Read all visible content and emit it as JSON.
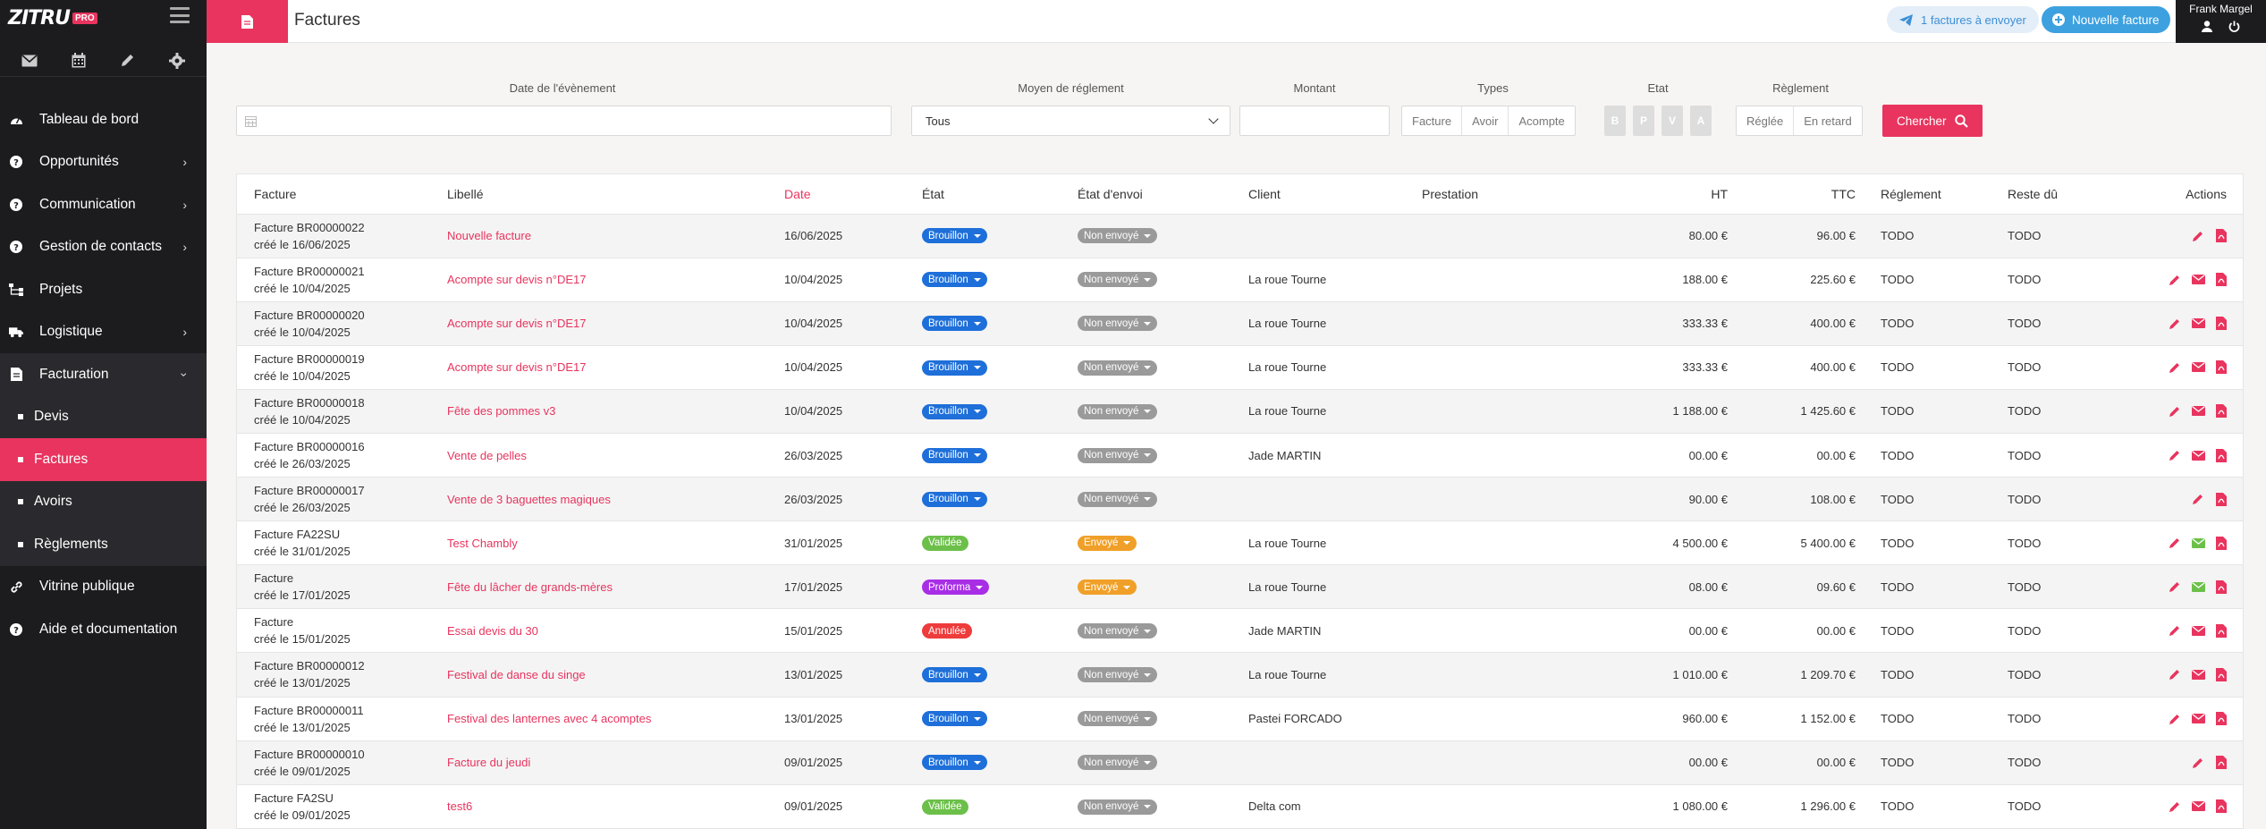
{
  "brand": {
    "name": "ZITRU",
    "badge": "PRO"
  },
  "sidebar": {
    "quick_icons": [
      "mail-icon",
      "calendar-icon",
      "pencil-icon",
      "gear-icon"
    ],
    "items": [
      {
        "label": "Tableau de bord",
        "icon": "dashboard-icon",
        "has_children": false
      },
      {
        "label": "Opportunités",
        "icon": "question-circle-icon",
        "has_children": true
      },
      {
        "label": "Communication",
        "icon": "question-circle-icon",
        "has_children": true
      },
      {
        "label": "Gestion de contacts",
        "icon": "question-circle-icon",
        "has_children": true
      },
      {
        "label": "Projets",
        "icon": "sitemap-icon",
        "has_children": false
      },
      {
        "label": "Logistique",
        "icon": "truck-icon",
        "has_children": true
      },
      {
        "label": "Facturation",
        "icon": "invoice-icon",
        "has_children": true,
        "open": true
      }
    ],
    "subitems": [
      {
        "label": "Devis",
        "active": false
      },
      {
        "label": "Factures",
        "active": true
      },
      {
        "label": "Avoirs",
        "active": false
      },
      {
        "label": "Règlements",
        "active": false
      }
    ],
    "bottom_items": [
      {
        "label": "Vitrine publique",
        "icon": "link-icon"
      },
      {
        "label": "Aide et documentation",
        "icon": "question-circle-icon"
      }
    ]
  },
  "topbar": {
    "title": "Factures",
    "send_button": "1 factures à envoyer",
    "new_button": "Nouvelle facture",
    "user_name": "Frank Margel"
  },
  "filters": {
    "date_label": "Date de l'évènement",
    "payment_label": "Moyen de réglement",
    "payment_value": "Tous",
    "amount_label": "Montant",
    "types_label": "Types",
    "types": [
      "Facture",
      "Avoir",
      "Acompte"
    ],
    "etat_label": "Etat",
    "etats": [
      "B",
      "P",
      "V",
      "A"
    ],
    "reglement_label": "Règlement",
    "reglements": [
      "Réglée",
      "En retard"
    ],
    "search_button": "Chercher"
  },
  "table": {
    "headers": {
      "facture": "Facture",
      "libelle": "Libellé",
      "date": "Date",
      "etat": "État",
      "envoi": "État d'envoi",
      "client": "Client",
      "prestation": "Prestation",
      "ht": "HT",
      "ttc": "TTC",
      "reglement": "Réglement",
      "reste": "Reste dû",
      "actions": "Actions"
    },
    "rows": [
      {
        "num": "Facture BR00000022",
        "created": "créé le 16/06/2025",
        "libelle": "Nouvelle facture",
        "date": "16/06/2025",
        "etat": "Brouillon",
        "envoi": "Non envoyé",
        "client": "",
        "prestation": "",
        "ht": "80.00 €",
        "ttc": "96.00 €",
        "reglement": "TODO",
        "reste": "TODO",
        "mail": false
      },
      {
        "num": "Facture BR00000021",
        "created": "créé le 10/04/2025",
        "libelle": "Acompte sur devis n°DE17",
        "date": "10/04/2025",
        "etat": "Brouillon",
        "envoi": "Non envoyé",
        "client": "La roue Tourne",
        "prestation": "",
        "ht": "188.00 €",
        "ttc": "225.60 €",
        "reglement": "TODO",
        "reste": "TODO",
        "mail": true
      },
      {
        "num": "Facture BR00000020",
        "created": "créé le 10/04/2025",
        "libelle": "Acompte sur devis n°DE17",
        "date": "10/04/2025",
        "etat": "Brouillon",
        "envoi": "Non envoyé",
        "client": "La roue Tourne",
        "prestation": "",
        "ht": "333.33 €",
        "ttc": "400.00 €",
        "reglement": "TODO",
        "reste": "TODO",
        "mail": true
      },
      {
        "num": "Facture BR00000019",
        "created": "créé le 10/04/2025",
        "libelle": "Acompte sur devis n°DE17",
        "date": "10/04/2025",
        "etat": "Brouillon",
        "envoi": "Non envoyé",
        "client": "La roue Tourne",
        "prestation": "",
        "ht": "333.33 €",
        "ttc": "400.00 €",
        "reglement": "TODO",
        "reste": "TODO",
        "mail": true
      },
      {
        "num": "Facture BR00000018",
        "created": "créé le 10/04/2025",
        "libelle": "Fête des pommes v3",
        "date": "10/04/2025",
        "etat": "Brouillon",
        "envoi": "Non envoyé",
        "client": "La roue Tourne",
        "prestation": "",
        "ht": "1 188.00 €",
        "ttc": "1 425.60 €",
        "reglement": "TODO",
        "reste": "TODO",
        "mail": true
      },
      {
        "num": "Facture BR00000016",
        "created": "créé le 26/03/2025",
        "libelle": "Vente de pelles",
        "date": "26/03/2025",
        "etat": "Brouillon",
        "envoi": "Non envoyé",
        "client": "Jade MARTIN",
        "prestation": "",
        "ht": "00.00 €",
        "ttc": "00.00 €",
        "reglement": "TODO",
        "reste": "TODO",
        "mail": true
      },
      {
        "num": "Facture BR00000017",
        "created": "créé le 26/03/2025",
        "libelle": "Vente de 3 baguettes magiques",
        "date": "26/03/2025",
        "etat": "Brouillon",
        "envoi": "Non envoyé",
        "client": "",
        "prestation": "",
        "ht": "90.00 €",
        "ttc": "108.00 €",
        "reglement": "TODO",
        "reste": "TODO",
        "mail": false
      },
      {
        "num": "Facture FA22SU",
        "created": "créé le 31/01/2025",
        "libelle": "Test Chambly",
        "date": "31/01/2025",
        "etat": "Validée",
        "envoi": "Envoyé",
        "client": "La roue Tourne",
        "prestation": "",
        "ht": "4 500.00 €",
        "ttc": "5 400.00 €",
        "reglement": "TODO",
        "reste": "TODO",
        "mail": true
      },
      {
        "num": "Facture",
        "created": "créé le 17/01/2025",
        "libelle": "Fête du lâcher de grands-mères",
        "date": "17/01/2025",
        "etat": "Proforma",
        "envoi": "Envoyé",
        "client": "La roue Tourne",
        "prestation": "",
        "ht": "08.00 €",
        "ttc": "09.60 €",
        "reglement": "TODO",
        "reste": "TODO",
        "mail": true
      },
      {
        "num": "Facture",
        "created": "créé le 15/01/2025",
        "libelle": "Essai devis du 30",
        "date": "15/01/2025",
        "etat": "Annulée",
        "envoi": "Non envoyé",
        "client": "Jade MARTIN",
        "prestation": "",
        "ht": "00.00 €",
        "ttc": "00.00 €",
        "reglement": "TODO",
        "reste": "TODO",
        "mail": true
      },
      {
        "num": "Facture BR00000012",
        "created": "créé le 13/01/2025",
        "libelle": "Festival de danse du singe",
        "date": "13/01/2025",
        "etat": "Brouillon",
        "envoi": "Non envoyé",
        "client": "La roue Tourne",
        "prestation": "",
        "ht": "1 010.00 €",
        "ttc": "1 209.70 €",
        "reglement": "TODO",
        "reste": "TODO",
        "mail": true
      },
      {
        "num": "Facture BR00000011",
        "created": "créé le 13/01/2025",
        "libelle": "Festival des lanternes avec 4 acomptes",
        "date": "13/01/2025",
        "etat": "Brouillon",
        "envoi": "Non envoyé",
        "client": "Pastei FORCADO",
        "prestation": "",
        "ht": "960.00 €",
        "ttc": "1 152.00 €",
        "reglement": "TODO",
        "reste": "TODO",
        "mail": true
      },
      {
        "num": "Facture BR00000010",
        "created": "créé le 09/01/2025",
        "libelle": "Facture du jeudi",
        "date": "09/01/2025",
        "etat": "Brouillon",
        "envoi": "Non envoyé",
        "client": "",
        "prestation": "",
        "ht": "00.00 €",
        "ttc": "00.00 €",
        "reglement": "TODO",
        "reste": "TODO",
        "mail": false
      },
      {
        "num": "Facture FA2SU",
        "created": "créé le 09/01/2025",
        "libelle": "test6",
        "date": "09/01/2025",
        "etat": "Validée",
        "envoi": "Non envoyé",
        "client": "Delta com",
        "prestation": "",
        "ht": "1 080.00 €",
        "ttc": "1 296.00 €",
        "reglement": "TODO",
        "reste": "TODO",
        "mail": true
      }
    ]
  },
  "colors": {
    "accent": "#e8345e",
    "Brouillon": "#1e6fd9",
    "Validée": "#6cc04a",
    "Proforma": "#a82ee6",
    "Annulée": "#ee3b3b",
    "Non envoyé": "#9a9a9a",
    "Envoyé": "#f0a028"
  }
}
